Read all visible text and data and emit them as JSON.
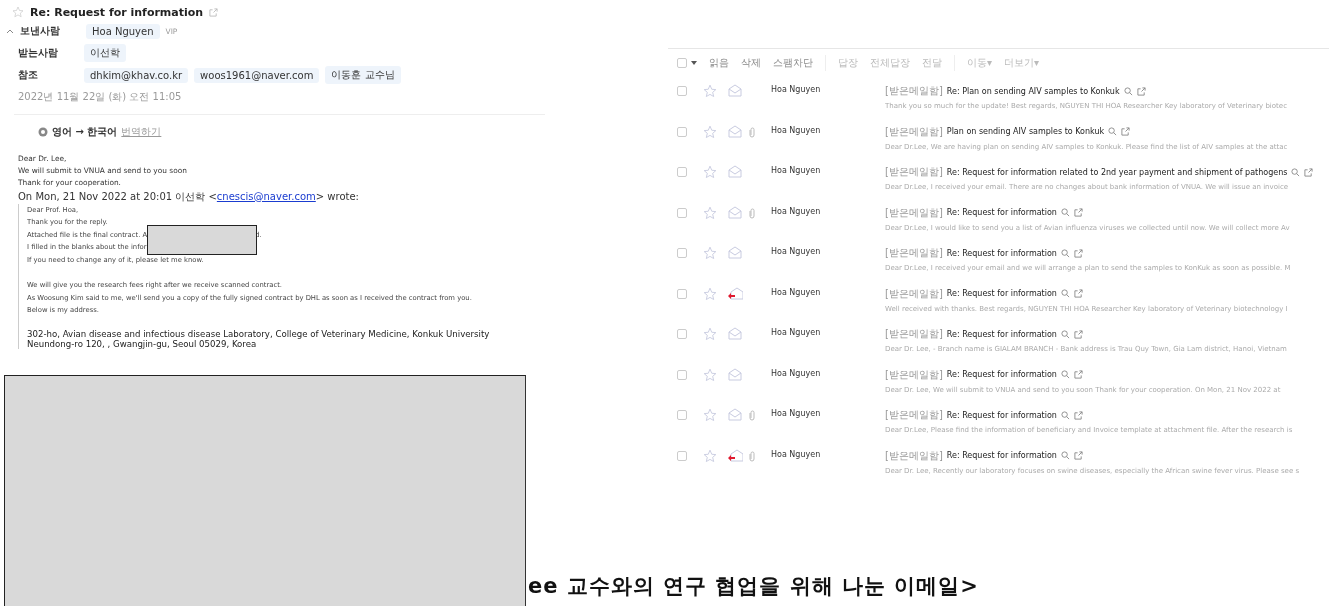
{
  "message": {
    "subject": "Re: Request for information",
    "sender_label": "보낸사람",
    "sender": "Hoa Nguyen",
    "sender_badge": "VIP",
    "to_label": "받는사람",
    "to": [
      "이선학"
    ],
    "cc_label": "참조",
    "cc": [
      "dhkim@khav.co.kr",
      "woos1961@naver.com",
      "이동훈 교수님"
    ],
    "date": "2022년 11월 22일 (화) 오전 11:05",
    "translate": {
      "langs": "영어 → 한국어",
      "action": "번역하기"
    },
    "body": [
      "Dear Dr. Lee,",
      "We will submit to VNUA and send to you soon",
      "Thank for your cooperation."
    ],
    "quote_header": {
      "before": "On Mon, 21 Nov 2022 at 20:01 이선학 <",
      "link": "cnescis@naver.com",
      "after": "> wrote:"
    },
    "quote": [
      {
        "text": "Dear Prof. Hoa,"
      },
      {
        "text": "Thank you for the reply."
      },
      {
        "text": "Attached file is the final contract. A",
        "tail": "d."
      },
      {
        "text": "I filled in the blanks about the infor"
      },
      {
        "text": "If you need to change any of it, please let me know."
      },
      {
        "text": "We will give you the research fees right after we receive scanned contract.",
        "spaced": true
      },
      {
        "text": "As Woosung Kim said to me, we'll send you a copy of the fully signed contract by DHL as soon as I received the contract from you."
      },
      {
        "text": "Below is my address."
      }
    ],
    "address": [
      "302-ho, Avian disease and infectious disease Laboratory, College of Veterinary Medicine, Konkuk University",
      "Neundong-ro 120, , Gwangjin-gu, Seoul 05029, Korea"
    ]
  },
  "toolbar": {
    "select_all_checked": false,
    "groups": [
      [
        "읽음",
        "삭제",
        "스팸차단"
      ],
      [
        "답장",
        "전체답장",
        "전달"
      ],
      [
        "이동▾",
        "더보기▾"
      ]
    ]
  },
  "mails": [
    {
      "sender": "Hoa Nguyen",
      "folder": "[받은메일함]",
      "subject": "Re: Plan on sending AIV samples to Konkuk",
      "preview": "Thank you so much for the update!  Best regards, NGUYEN THI HOA Researcher Key laboratory of Veterinary biotec",
      "replied": false,
      "attachment": false,
      "checked": false
    },
    {
      "sender": "Hoa Nguyen",
      "folder": "[받은메일함]",
      "subject": "Plan on sending AIV samples to Konkuk",
      "preview": "Dear Dr.Lee, We are having plan on sending AIV samples to Konkuk. Please find the list of AIV samples at the attac",
      "replied": false,
      "attachment": true,
      "checked": false
    },
    {
      "sender": "Hoa Nguyen",
      "folder": "[받은메일함]",
      "subject": "Re: Request for information related to 2nd year payment and shipment of pathogens",
      "preview": "Dear Dr.Lee, I received your email. There are no changes about bank information of VNUA. We will issue an invoice",
      "replied": false,
      "attachment": false,
      "checked": false
    },
    {
      "sender": "Hoa Nguyen",
      "folder": "[받은메일함]",
      "subject": "Re: Request for information",
      "preview": "Dear Dr.Lee, I would like to send you a list of Avian influenza viruses we collected until now. We will collect more Av",
      "replied": false,
      "attachment": true,
      "checked": false
    },
    {
      "sender": "Hoa Nguyen",
      "folder": "[받은메일함]",
      "subject": "Re: Request for information",
      "preview": "Dear Dr.Lee, I received your email and we will arrange a plan to send the samples to KonKuk as soon as possible. M",
      "replied": false,
      "attachment": false,
      "checked": false
    },
    {
      "sender": "Hoa Nguyen",
      "folder": "[받은메일함]",
      "subject": "Re: Request for information",
      "preview": "Well received with thanks.  Best regards, NGUYEN THI HOA Researcher Key laboratory of Veterinary biotechnology I",
      "replied": true,
      "attachment": false,
      "checked": false
    },
    {
      "sender": "Hoa Nguyen",
      "folder": "[받은메일함]",
      "subject": "Re: Request for information",
      "preview": "Dear Dr. Lee, - Branch name is GIALAM BRANCH - Bank address is Trau Quy Town, Gia Lam district, Hanoi, Vietnam",
      "replied": false,
      "attachment": false,
      "checked": false
    },
    {
      "sender": "Hoa Nguyen",
      "folder": "[받은메일함]",
      "subject": "Re: Request for information",
      "preview": "Dear Dr. Lee, We will submit to VNUA and send to you soon Thank for your cooperation. On Mon, 21 Nov 2022 at",
      "replied": false,
      "attachment": false,
      "checked": false
    },
    {
      "sender": "Hoa Nguyen",
      "folder": "[받은메일함]",
      "subject": "Re: Request for information",
      "preview": "Dear Dr.Lee, Please find the information of beneficiary and Invoice template at attachment file. After the research is",
      "replied": false,
      "attachment": true,
      "checked": false
    },
    {
      "sender": "Hoa Nguyen",
      "folder": "[받은메일함]",
      "subject": "Re: Request for information",
      "preview": "Dear Dr. Lee, Recently our laboratory focuses on swine diseases, especially the African swine fever virus. Please see s",
      "replied": true,
      "attachment": true,
      "checked": false
    }
  ],
  "caption": "ee 교수와의 연구 협업을 위해 나눈 이메일>"
}
